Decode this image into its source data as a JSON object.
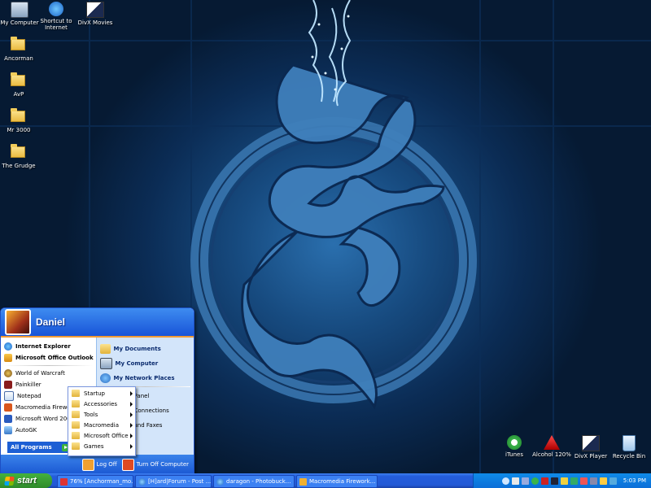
{
  "desktop": {
    "icons_left": [
      {
        "label": "My Computer",
        "icon": "my-computer-icon"
      },
      {
        "label": "Shortcut to Internet",
        "icon": "internet-explorer-icon"
      },
      {
        "label": "DivX Movies",
        "icon": "divx-icon"
      }
    ],
    "folders": [
      {
        "label": "Ancorman",
        "icon": "folder-icon"
      },
      {
        "label": "AvP",
        "icon": "folder-icon"
      },
      {
        "label": "Mr 3000",
        "icon": "folder-icon"
      },
      {
        "label": "The Grudge",
        "icon": "folder-icon"
      }
    ],
    "icons_right": [
      {
        "label": "iTunes",
        "icon": "itunes-icon"
      },
      {
        "label": "Alcohol 120%",
        "icon": "alcohol-icon"
      },
      {
        "label": "DivX Player",
        "icon": "divx-player-icon"
      },
      {
        "label": "Recycle Bin",
        "icon": "recycle-bin-icon"
      }
    ]
  },
  "start_menu": {
    "username": "Daniel",
    "pinned": [
      {
        "label": "Internet Explorer",
        "icon": "internet-explorer-icon"
      },
      {
        "label": "Microsoft Office Outlook",
        "icon": "outlook-icon"
      }
    ],
    "recent": [
      {
        "label": "World of Warcraft",
        "icon": "wow-icon"
      },
      {
        "label": "Painkiller",
        "icon": "painkiller-icon"
      },
      {
        "label": "Notepad",
        "icon": "notepad-icon"
      },
      {
        "label": "Macromedia Fireworks",
        "icon": "fireworks-icon"
      },
      {
        "label": "Microsoft Word 2003",
        "icon": "word-icon"
      },
      {
        "label": "AutoGK",
        "icon": "autogk-icon"
      }
    ],
    "all_programs": "All Programs",
    "right": [
      {
        "label": "My Documents",
        "icon": "my-documents-icon"
      },
      {
        "label": "My Computer",
        "icon": "my-computer-icon"
      },
      {
        "label": "My Network Places",
        "icon": "network-icon"
      },
      {
        "label": "Panel",
        "icon": "control-panel-icon"
      },
      {
        "label": "Connections",
        "icon": "connections-icon"
      },
      {
        "label": "and Faxes",
        "icon": "printers-icon"
      }
    ],
    "log_off": "Log Off",
    "turn_off": "Turn Off Computer"
  },
  "submenu": {
    "items": [
      "Startup",
      "Accessories",
      "Tools",
      "Macromedia",
      "Microsoft Office",
      "Games"
    ]
  },
  "taskbar": {
    "start": "start",
    "tasks": [
      {
        "label": "76% [Anchorman_mo...",
        "icon": "autogk-task-icon"
      },
      {
        "label": "[H]ard|Forum - Post ...",
        "icon": "ie-task-icon"
      },
      {
        "label": "daragon - Photobuck...",
        "icon": "ie-task-icon"
      },
      {
        "label": "Macromedia Firework...",
        "icon": "fireworks-task-icon"
      }
    ],
    "clock": "5:03 PM"
  },
  "colors": {
    "taskbar_blue": "#245ddb",
    "start_green": "#3c9a35",
    "menu_orange": "#f29b35"
  }
}
